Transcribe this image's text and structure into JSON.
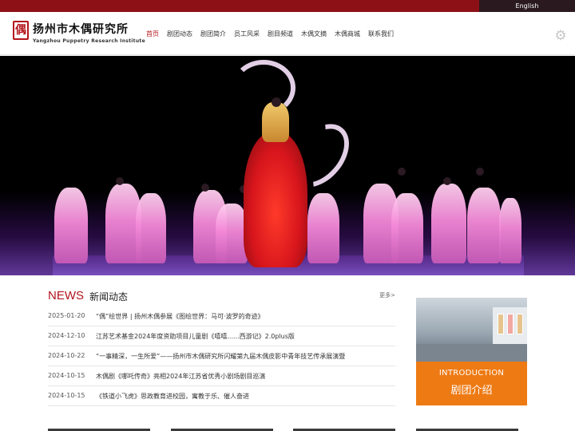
{
  "topbar": {
    "language_label": "English"
  },
  "header": {
    "logo_cn": "扬州市木偶研究所",
    "logo_en": "Yangzhou Puppetry Research Institute",
    "nav": [
      {
        "label": "首页",
        "active": true
      },
      {
        "label": "剧团动态"
      },
      {
        "label": "剧团简介"
      },
      {
        "label": "员工风采"
      },
      {
        "label": "剧目频道"
      },
      {
        "label": "木偶文摘"
      },
      {
        "label": "木偶商城"
      },
      {
        "label": "联系我们"
      }
    ],
    "settings_icon": "gear-icon"
  },
  "banner": {
    "description_icon": "stage-photo"
  },
  "news": {
    "heading_en": "NEWS",
    "heading_cn": "新闻动态",
    "more_label": "更多>",
    "items": [
      {
        "date": "2025-01-20",
        "title": "“偶”绘世界 | 扬州木偶参展《图绘世界：马可·波罗的奇迹》"
      },
      {
        "date": "2024-12-10",
        "title": "江苏艺术基金2024年度资助项目儿童剧《嘻嘻......西游记》2.0plus版"
      },
      {
        "date": "2024-10-22",
        "title": "“一事精深，一生所爱”——扬州市木偶研究所闪耀第九届木偶皮影中青年技艺传承展演暨"
      },
      {
        "date": "2024-10-15",
        "title": "木偶剧《哪吒传奇》亮相2024年江苏省优秀小剧场剧目巡演"
      },
      {
        "date": "2024-10-15",
        "title": "《铁道小飞虎》思政教育进校园，寓教于乐、催人奋进"
      }
    ]
  },
  "intro": {
    "heading_en": "INTRODUCTION",
    "heading_cn": "剧团介绍"
  },
  "colors": {
    "brand_red": "#b3151c",
    "topbar": "#8e1017",
    "intro_orange": "#ee7a14"
  }
}
